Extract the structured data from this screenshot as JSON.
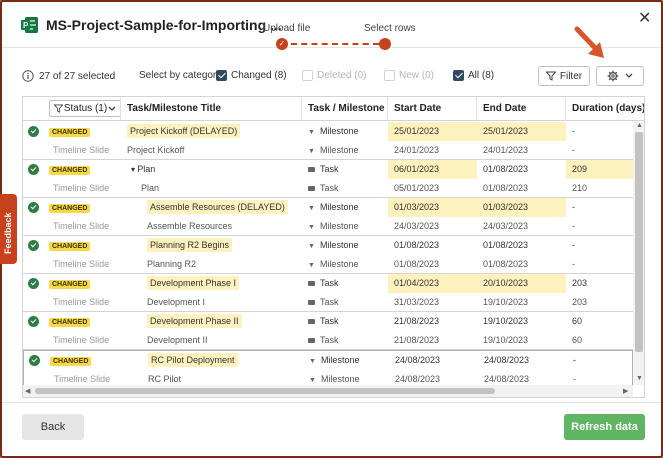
{
  "header": {
    "title": "MS-Project-Sample-for-Importing ...",
    "close_glyph": "✕",
    "steps": [
      {
        "label": "Upload file",
        "glyph": "✓"
      },
      {
        "label": "Select rows",
        "glyph": ""
      }
    ]
  },
  "toolbar": {
    "selected_count": "27 of 27 selected",
    "category_label": "Select by category:",
    "categories": [
      {
        "label": "Changed (8)",
        "checked": true,
        "disabled": false
      },
      {
        "label": "Deleted (0)",
        "checked": false,
        "disabled": true
      },
      {
        "label": "New (0)",
        "checked": false,
        "disabled": true
      },
      {
        "label": "All (8)",
        "checked": true,
        "disabled": false
      }
    ],
    "filter_label": "Filter"
  },
  "grid": {
    "columns": [
      "Status (1)",
      "Task/Milestone Title",
      "Task / Milestone",
      "Start Date",
      "End Date",
      "Duration (days)"
    ],
    "changed_badge": "CHANGED",
    "timeline_label": "Timeline Slide",
    "groups": [
      {
        "new": {
          "title": "Project Kickoff (DELAYED)",
          "type": "Milestone",
          "start": "25/01/2023",
          "end": "25/01/2023",
          "duration": "-"
        },
        "old": {
          "title": "Project Kickoff",
          "type": "Milestone",
          "start": "24/01/2023",
          "end": "24/01/2023",
          "duration": "-"
        }
      },
      {
        "new": {
          "title": "Plan",
          "type": "Task",
          "start": "06/01/2023",
          "end": "01/08/2023",
          "duration": "209"
        },
        "old": {
          "title": "Plan",
          "type": "Task",
          "start": "05/01/2023",
          "end": "01/08/2023",
          "duration": "210"
        }
      },
      {
        "new": {
          "title": "Assemble Resources (DELAYED)",
          "type": "Milestone",
          "start": "01/03/2023",
          "end": "01/03/2023",
          "duration": "-"
        },
        "old": {
          "title": "Assemble Resources",
          "type": "Milestone",
          "start": "24/03/2023",
          "end": "24/03/2023",
          "duration": "-"
        }
      },
      {
        "new": {
          "title": "Planning R2 Begins",
          "type": "Milestone",
          "start": "01/08/2023",
          "end": "01/08/2023",
          "duration": "-"
        },
        "old": {
          "title": "Planning R2",
          "type": "Milestone",
          "start": "01/08/2023",
          "end": "01/08/2023",
          "duration": "-"
        }
      },
      {
        "new": {
          "title": "Development Phase I",
          "type": "Task",
          "start": "01/04/2023",
          "end": "20/10/2023",
          "duration": "203"
        },
        "old": {
          "title": "Development I",
          "type": "Task",
          "start": "31/03/2023",
          "end": "19/10/2023",
          "duration": "203"
        }
      },
      {
        "new": {
          "title": "Development Phase II",
          "type": "Task",
          "start": "21/08/2023",
          "end": "19/10/2023",
          "duration": "60"
        },
        "old": {
          "title": "Development II",
          "type": "Task",
          "start": "21/08/2023",
          "end": "19/10/2023",
          "duration": "60"
        }
      },
      {
        "new": {
          "title": "RC Pilot Deployment",
          "type": "Milestone",
          "start": "24/08/2023",
          "end": "24/08/2023",
          "duration": "-"
        },
        "old": {
          "title": "RC Pilot",
          "type": "Milestone",
          "start": "24/08/2023",
          "end": "24/08/2023",
          "duration": "-"
        }
      }
    ]
  },
  "footer": {
    "back_label": "Back",
    "refresh_label": "Refresh data"
  },
  "feedback_label": "Feedback",
  "colors": {
    "accent": "#c6411c",
    "changed_badge": "#f7d948",
    "highlight": "#fdf1be",
    "refresh_button": "#5fb562"
  }
}
